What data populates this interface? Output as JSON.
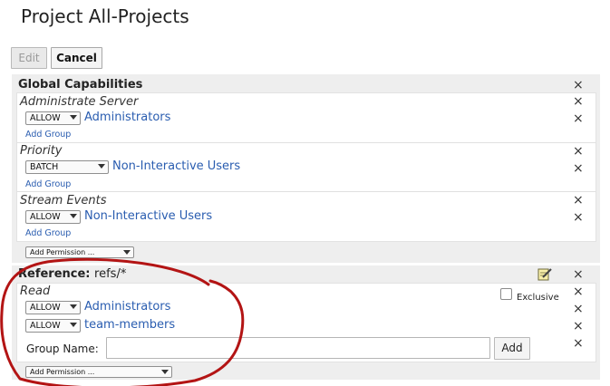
{
  "page": {
    "title": "Project All-Projects"
  },
  "toolbar": {
    "edit_label": "Edit",
    "cancel_label": "Cancel"
  },
  "global_capabilities": {
    "heading": "Global Capabilities",
    "permissions": [
      {
        "name": "Administrate Server",
        "rules": [
          {
            "action": "ALLOW",
            "group": "Administrators"
          }
        ],
        "add_group_label": "Add Group"
      },
      {
        "name": "Priority",
        "rules": [
          {
            "action": "BATCH",
            "group": "Non-Interactive Users"
          }
        ],
        "add_group_label": "Add Group"
      },
      {
        "name": "Stream Events",
        "rules": [
          {
            "action": "ALLOW",
            "group": "Non-Interactive Users"
          }
        ],
        "add_group_label": "Add Group"
      }
    ],
    "add_permission_label": "Add Permission ..."
  },
  "reference": {
    "heading": "Reference:",
    "ref_pattern": "refs/*",
    "permission": {
      "name": "Read",
      "exclusive_label": "Exclusive",
      "exclusive_checked": false,
      "rules": [
        {
          "action": "ALLOW",
          "group": "Administrators"
        },
        {
          "action": "ALLOW",
          "group": "team-members"
        }
      ],
      "group_name_label": "Group Name:",
      "group_name_value": "",
      "add_button_label": "Add"
    },
    "add_permission_label": "Add Permission ..."
  },
  "icons": {
    "close": "close-icon",
    "edit": "edit-note-icon"
  },
  "colors": {
    "link": "#2a5db0",
    "annotation": "#b31414",
    "panel_bg": "#eeeeee"
  }
}
